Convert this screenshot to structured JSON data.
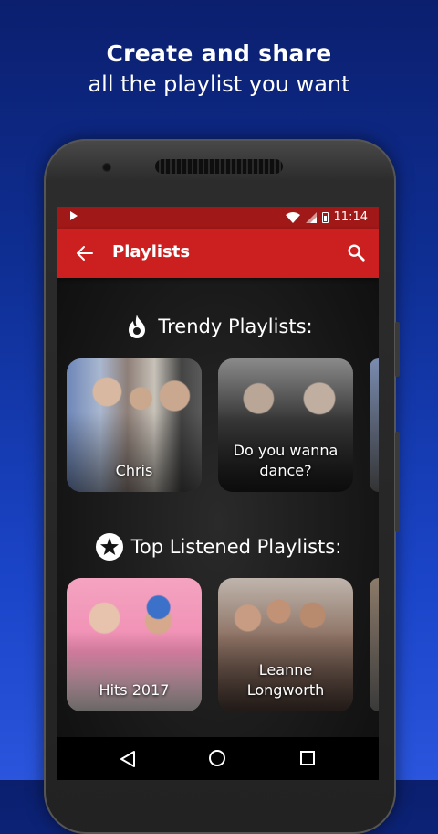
{
  "promo": {
    "title": "Create and share",
    "subtitle": "all the playlist you want"
  },
  "status_bar": {
    "time": "11:14"
  },
  "app_bar": {
    "title": "Playlists"
  },
  "sections": [
    {
      "title": "Trendy Playlists:",
      "icon": "flame-icon",
      "cards": [
        {
          "label": "Chris"
        },
        {
          "label": "Do you wanna dance?"
        }
      ]
    },
    {
      "title": "Top Listened Playlists:",
      "icon": "star-icon",
      "cards": [
        {
          "label": "Hits 2017"
        },
        {
          "label": "Leanne Longworth"
        }
      ]
    }
  ],
  "colors": {
    "status_bar": "#a01818",
    "app_bar": "#cc2020",
    "background_top": "#0b1f6e",
    "background_bottom": "#2a55dc"
  }
}
